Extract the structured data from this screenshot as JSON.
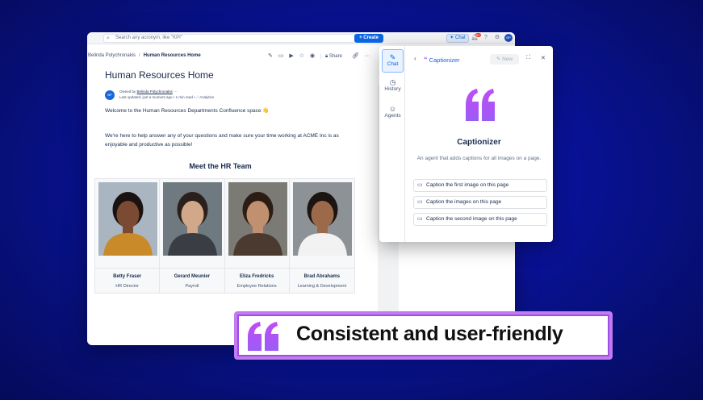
{
  "topbar": {
    "search_placeholder": "Search any acronym, like \"KPI\"",
    "create_label": "Create",
    "chat_label": "Chat",
    "notif_count": "9+",
    "avatar_initials": "BP"
  },
  "breadcrumb": {
    "parent": "Belinda Polychronakis",
    "current": "Human Resources Home"
  },
  "page_actions": {
    "share_label": "Share"
  },
  "page": {
    "title": "Human Resources Home",
    "author_initials": "BP",
    "owned_by_prefix": "Owned by",
    "owner": "Belinda Polychronakis",
    "last_updated": "Last updated: just a moment ago",
    "read_time": "1 min read",
    "analytics": "Analytics",
    "welcome": "Welcome to the Human Resources Departments Confluence space 👋",
    "intro": "We're here to help answer any of your questions and make sure your time working at ACME Inc is as enjoyable and productive as possible!",
    "team_title": "Meet the HR Team",
    "team": [
      {
        "name": "Betty Fraser",
        "role": "HR Director",
        "skin": "#7a4a32",
        "hair": "#1a1210",
        "shirt": "#c98a2a",
        "bg": "#a9b6c2"
      },
      {
        "name": "Gerard Meunier",
        "role": "Payroll",
        "skin": "#d2a88a",
        "hair": "#2a1f1a",
        "shirt": "#3a3d44",
        "bg": "#6f7a80"
      },
      {
        "name": "Eliza Fredricks",
        "role": "Employee Relations",
        "skin": "#c09070",
        "hair": "#2c1d14",
        "shirt": "#4a3a30",
        "bg": "#7c7a74"
      },
      {
        "name": "Brad Abrahams",
        "role": "Learning & Development",
        "skin": "#9c6a4a",
        "hair": "#1b1410",
        "shirt": "#f2f2f2",
        "bg": "#8d9296"
      }
    ]
  },
  "panel": {
    "nav": [
      {
        "label": "Chat",
        "icon": "chat-edit-icon"
      },
      {
        "label": "History",
        "icon": "clock-icon"
      },
      {
        "label": "Agents",
        "icon": "agents-icon"
      }
    ],
    "agent_name": "Captionizer",
    "new_label": "New",
    "agent_title": "Captionizer",
    "agent_desc": "An agent that adds captions for all images on a page.",
    "suggestions": [
      "Caption the first image on this page",
      "Caption the images on this page",
      "Caption the second image on this page"
    ],
    "accent": "#a855f7"
  },
  "banner": {
    "text": "Consistent and user-friendly",
    "border": "#c27cf0"
  }
}
